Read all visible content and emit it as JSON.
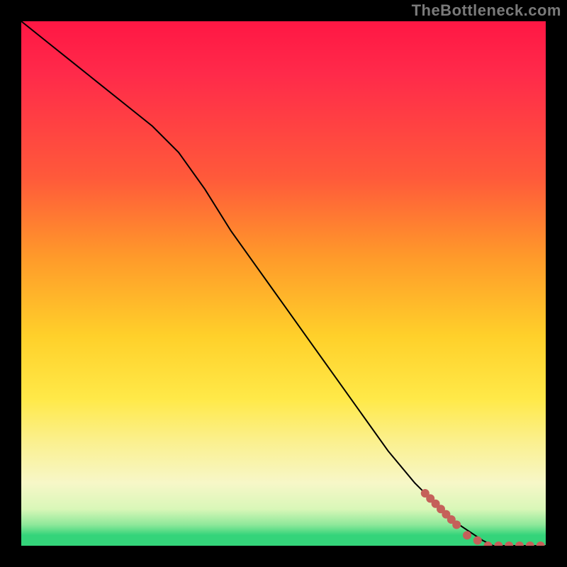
{
  "watermark": "TheBottleneck.com",
  "colors": {
    "gradient_top": "#ff1744",
    "gradient_mid": "#ffd02a",
    "gradient_bottom": "#34d47a",
    "line": "#000000",
    "marker": "#c5605a",
    "frame": "#000000"
  },
  "chart_data": {
    "type": "line",
    "title": "",
    "xlabel": "",
    "ylabel": "",
    "xlim": [
      0,
      100
    ],
    "ylim": [
      0,
      100
    ],
    "grid": false,
    "legend": false,
    "annotations": [
      {
        "text": "TheBottleneck.com",
        "position": "top-right"
      }
    ],
    "series": [
      {
        "name": "bottleneck-curve",
        "x": [
          0,
          5,
          10,
          15,
          20,
          25,
          30,
          35,
          40,
          45,
          50,
          55,
          60,
          65,
          70,
          75,
          80,
          82,
          85,
          88,
          90,
          92,
          94,
          96,
          98,
          100
        ],
        "y": [
          100,
          96,
          92,
          88,
          84,
          80,
          75,
          68,
          60,
          53,
          46,
          39,
          32,
          25,
          18,
          12,
          7,
          5,
          3,
          1,
          0,
          0,
          0,
          0,
          0,
          0
        ]
      }
    ],
    "markers": {
      "name": "highlight-segment",
      "x": [
        77,
        78,
        79,
        80,
        81,
        82,
        83,
        85,
        87,
        89,
        91,
        93,
        95,
        97,
        99
      ],
      "y": [
        10,
        9,
        8,
        7,
        6,
        5,
        4,
        2,
        1,
        0,
        0,
        0,
        0,
        0,
        0
      ]
    }
  }
}
